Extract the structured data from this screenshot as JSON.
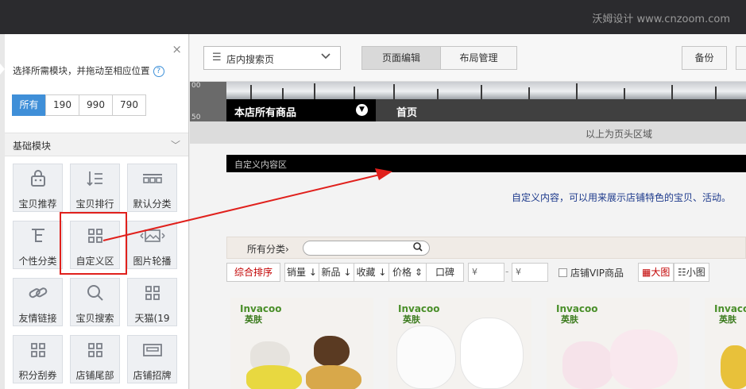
{
  "watermark": "沃姆设计 www.cnzoom.com",
  "panel": {
    "close_glyph": "×",
    "tip": "选择所需模块，并拖动至相应位置",
    "help_glyph": "?",
    "width_tabs": [
      "所有",
      "190",
      "990",
      "790"
    ],
    "section_title": "基础模块",
    "modules": [
      {
        "label": "宝贝推荐",
        "icon": "bag-icon"
      },
      {
        "label": "宝贝排行",
        "icon": "ranking-icon"
      },
      {
        "label": "默认分类",
        "icon": "category-icon"
      },
      {
        "label": "个性分类",
        "icon": "tree-icon"
      },
      {
        "label": "自定义区",
        "icon": "grid-icon"
      },
      {
        "label": "图片轮播",
        "icon": "image-icon"
      },
      {
        "label": "友情链接",
        "icon": "link-icon"
      },
      {
        "label": "宝贝搜索",
        "icon": "search-icon"
      },
      {
        "label": "天猫(19",
        "icon": "grid-icon"
      },
      {
        "label": "积分刮券",
        "icon": "grid-icon"
      },
      {
        "label": "店铺尾部",
        "icon": "grid-icon"
      },
      {
        "label": "店铺招牌",
        "icon": "signboard-icon"
      }
    ]
  },
  "toolbar": {
    "page_select": "店内搜索页",
    "edit_label": "页面编辑",
    "layout_label": "布局管理",
    "backup_label": "备份"
  },
  "ruler": {
    "top": "00",
    "bottom": "50"
  },
  "nav": {
    "all_items": "本店所有商品",
    "home": "首页"
  },
  "header_note": "以上为页头区域",
  "custom": {
    "bar_label": "自定义内容区",
    "desc": "自定义内容，可以用来展示店铺特色的宝贝、活动。"
  },
  "category": {
    "label": "所有分类",
    "arrow": "›"
  },
  "sort": {
    "items": [
      "综合排序",
      "销量",
      "新品",
      "收藏",
      "价格"
    ],
    "reputation": "口碑",
    "price_symbol": "¥",
    "price_dash": "-",
    "vip": "店铺VIP商品",
    "big_view": "大图",
    "small_view": "小图"
  },
  "products": [
    {
      "brand": "Invacoo",
      "brand_cn": "英肤"
    },
    {
      "brand": "Invacoo",
      "brand_cn": "英肤"
    },
    {
      "brand": "Invacoo",
      "brand_cn": "英肤"
    },
    {
      "brand": "Invacoo",
      "brand_cn": "英肤"
    }
  ],
  "colors": {
    "accent": "#3f8fd8",
    "annotation_red": "#e0201c",
    "sort_active": "#c20000"
  }
}
